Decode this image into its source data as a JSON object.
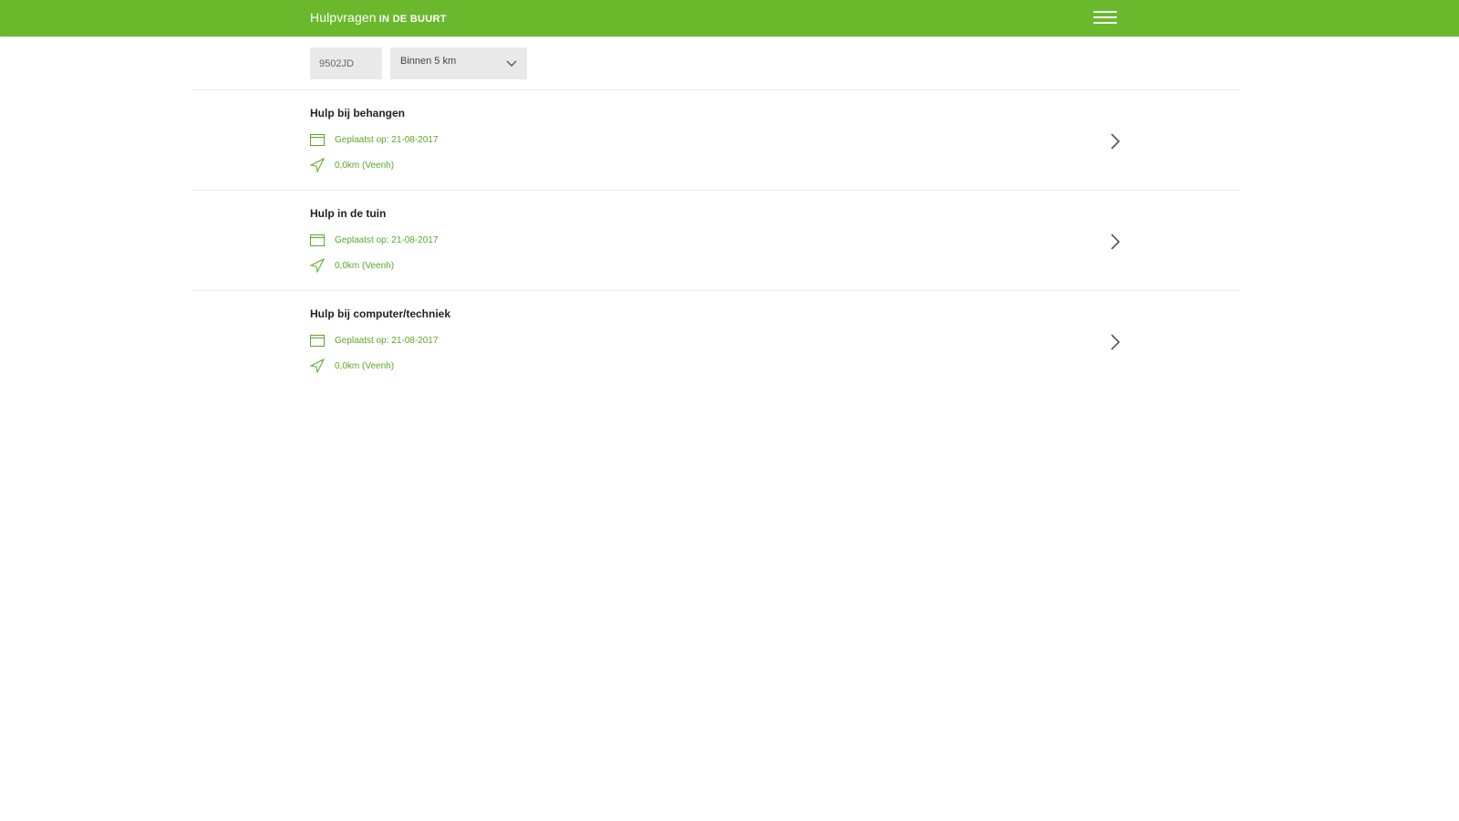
{
  "header": {
    "brand_main": "Hulpvragen",
    "brand_sub": "IN DE BUURT",
    "menu_icon": "hamburger-menu-icon"
  },
  "filters": {
    "postcode_value": "9502JD",
    "distance_selected": "Binnen 5 km"
  },
  "requests": [
    {
      "title": "Hulp bij behangen",
      "date": "Geplaatst op: 21-08-2017",
      "distance": "0,0km (Veenh)"
    },
    {
      "title": "Hulp in de tuin",
      "date": "Geplaatst op: 21-08-2017",
      "distance": "0,0km (Veenh)"
    },
    {
      "title": "Hulp bij computer/techniek",
      "date": "Geplaatst op: 21-08-2017",
      "distance": "0,0km (Veenh)"
    }
  ],
  "colors": {
    "brand_green": "#6ab82c",
    "meta_green": "#5aa828",
    "field_gray": "#e9e9e9"
  }
}
